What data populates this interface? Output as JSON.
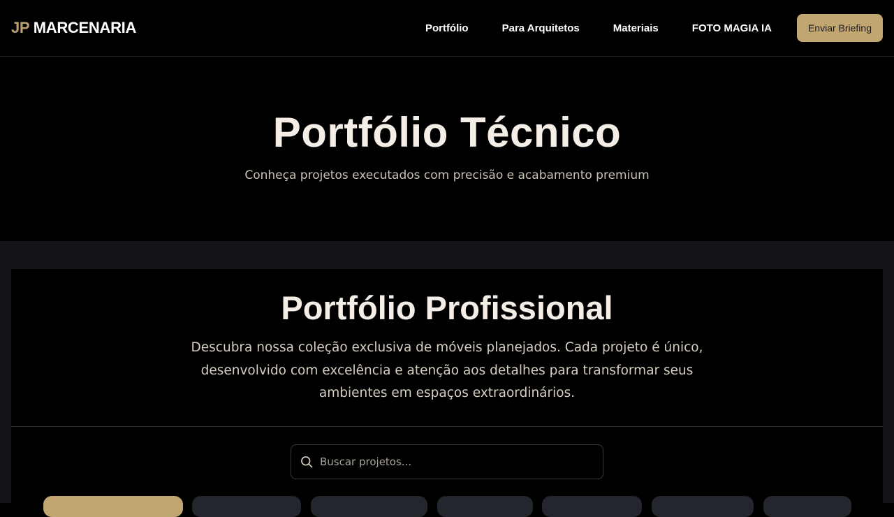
{
  "header": {
    "logo_prefix": "JP",
    "logo_name": "MARCENARIA",
    "nav": [
      "Portfólio",
      "Para Arquitetos",
      "Materiais",
      "FOTO MAGIA IA"
    ],
    "cta_label": "Enviar Briefing"
  },
  "hero": {
    "title": "Portfólio Técnico",
    "subtitle": "Conheça projetos executados com precisão e acabamento premium"
  },
  "portfolio": {
    "title": "Portfólio Profissional",
    "description": "Descubra nossa coleção exclusiva de móveis planejados. Cada projeto é único, desenvolvido com excelência e atenção aos detalhes para transformar seus ambientes em espaços extraordinários.",
    "search_placeholder": "Buscar projetos...",
    "search_icon": "search-icon",
    "filter_chips_visible": 8,
    "active_filter_index": 0
  },
  "colors": {
    "accent": "#c2a672",
    "background": "#000000",
    "section_bg": "#13141a",
    "heading": "#f4eee6",
    "chip_bg": "#24262e"
  }
}
